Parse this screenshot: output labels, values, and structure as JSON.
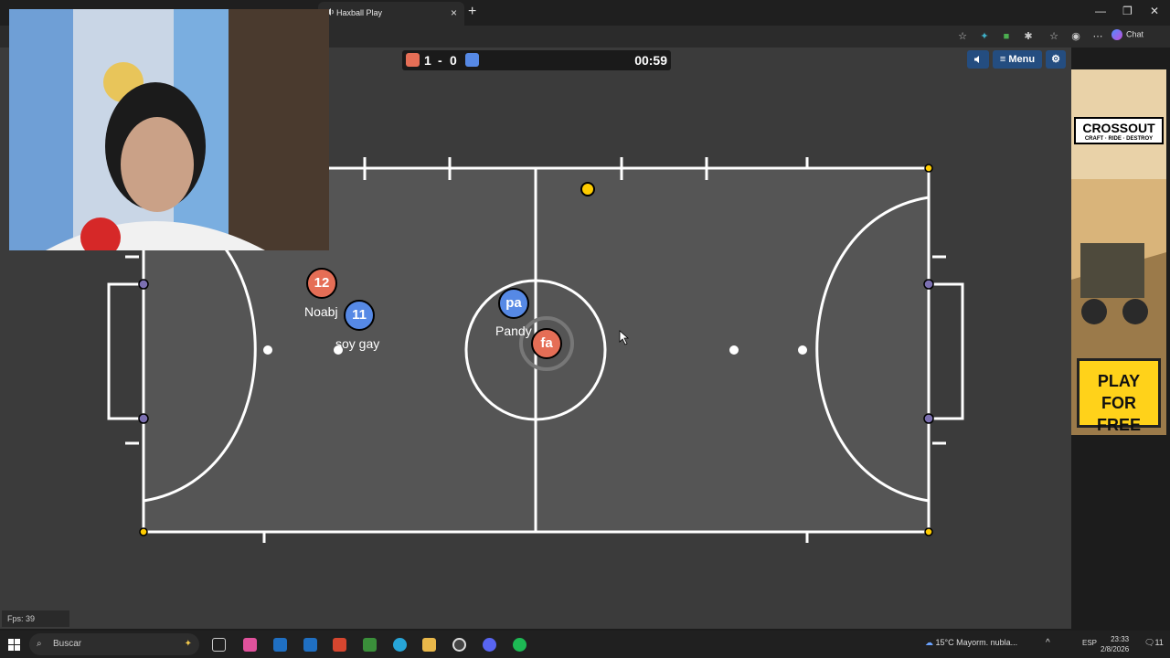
{
  "browser": {
    "tab_title": "Haxball Play",
    "tab_close": "×",
    "new_tab": "+",
    "chat_label": "Chat",
    "window_min": "—",
    "window_max": "❐",
    "window_close": "✕"
  },
  "game": {
    "score_red": "1",
    "score_separator": "-",
    "score_blue": "0",
    "timer": "00:59",
    "menu_label": "Menu",
    "fps": "Fps: 39",
    "red_color": "#e56e56",
    "blue_color": "#5689e5",
    "ball_color": "#ffcc00",
    "players": [
      {
        "team": "red",
        "avatar": "12",
        "name": "Noabj"
      },
      {
        "team": "blue",
        "avatar": "11",
        "name": "soy gay"
      },
      {
        "team": "blue",
        "avatar": "pa",
        "name": "Pandy"
      },
      {
        "team": "red",
        "avatar": "fa",
        "name": ""
      }
    ]
  },
  "ad": {
    "brand": "CROSSOUT",
    "tagline": "CRAFT · RIDE · DESTROY",
    "cta_line1": "PLAY",
    "cta_line2": "FOR FREE"
  },
  "taskbar": {
    "search_placeholder": "Buscar",
    "weather": "15°C  Mayorm. nubla...",
    "language": "ESP",
    "time": "23:33",
    "date": "2/8/2026",
    "notification_count": "11"
  }
}
